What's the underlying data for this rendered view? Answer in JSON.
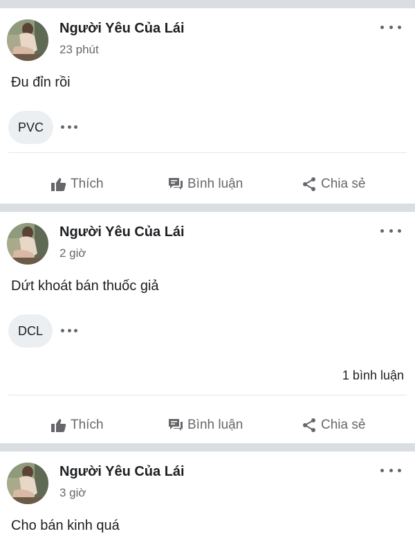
{
  "posts": [
    {
      "author": "Người Yêu Của Lái",
      "time": "23 phút",
      "text": "Đu đỉn rồi",
      "reaction_label": "PVC",
      "comment_count": "",
      "actions": {
        "like": "Thích",
        "comment": "Bình luận",
        "share": "Chia sẻ"
      }
    },
    {
      "author": "Người Yêu Của Lái",
      "time": "2 giờ",
      "text": "Dứt khoát bán thuốc giả",
      "reaction_label": "DCL",
      "comment_count": "1 bình luận",
      "actions": {
        "like": "Thích",
        "comment": "Bình luận",
        "share": "Chia sẻ"
      }
    },
    {
      "author": "Người Yêu Của Lái",
      "time": "3 giờ",
      "text": "Cho bán kinh quá"
    }
  ],
  "colors": {
    "background": "#dadde1",
    "card": "#ffffff",
    "muted_text": "#65676b",
    "pill": "#eceff1"
  },
  "icons": {
    "like": "thumbs-up-icon",
    "comment": "speech-bubbles-icon",
    "share": "share-nodes-icon",
    "menu": "more-horizontal-icon"
  }
}
